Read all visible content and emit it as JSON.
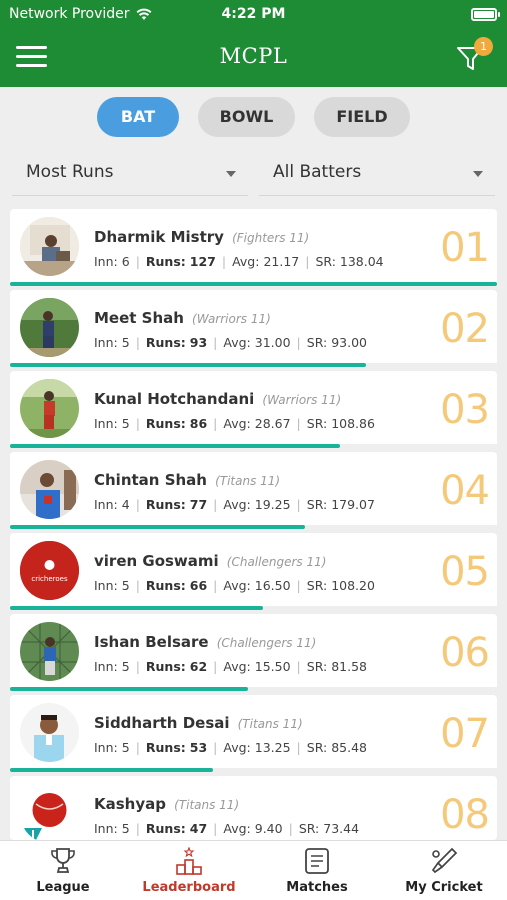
{
  "status_bar": {
    "carrier": "Network Provider",
    "time": "4:22 PM"
  },
  "header": {
    "title": "MCPL",
    "filter_badge": "1"
  },
  "tabs": [
    {
      "label": "BAT",
      "active": true
    },
    {
      "label": "BOWL",
      "active": false
    },
    {
      "label": "FIELD",
      "active": false
    }
  ],
  "filters": {
    "stat": "Most Runs",
    "players": "All Batters"
  },
  "labels": {
    "inn": "Inn:",
    "runs": "Runs:",
    "avg": "Avg:",
    "sr": "SR:"
  },
  "players": [
    {
      "rank": "01",
      "name": "Dharmik Mistry",
      "team": "(Fighters 11)",
      "inn": "6",
      "runs": "127",
      "avg": "21.17",
      "sr": "138.04",
      "progress": 1.0
    },
    {
      "rank": "02",
      "name": "Meet Shah",
      "team": "(Warriors 11)",
      "inn": "5",
      "runs": "93",
      "avg": "31.00",
      "sr": "93.00",
      "progress": 0.732
    },
    {
      "rank": "03",
      "name": "Kunal Hotchandani",
      "team": "(Warriors 11)",
      "inn": "5",
      "runs": "86",
      "avg": "28.67",
      "sr": "108.86",
      "progress": 0.677
    },
    {
      "rank": "04",
      "name": "Chintan Shah",
      "team": "(Titans 11)",
      "inn": "4",
      "runs": "77",
      "avg": "19.25",
      "sr": "179.07",
      "progress": 0.606
    },
    {
      "rank": "05",
      "name": "viren Goswami",
      "team": "(Challengers 11)",
      "inn": "5",
      "runs": "66",
      "avg": "16.50",
      "sr": "108.20",
      "progress": 0.52,
      "avatar_text": "cricheroes"
    },
    {
      "rank": "06",
      "name": "Ishan Belsare",
      "team": "(Challengers 11)",
      "inn": "5",
      "runs": "62",
      "avg": "15.50",
      "sr": "81.58",
      "progress": 0.488
    },
    {
      "rank": "07",
      "name": "Siddharth Desai",
      "team": "(Titans 11)",
      "inn": "5",
      "runs": "53",
      "avg": "13.25",
      "sr": "85.48",
      "progress": 0.417
    },
    {
      "rank": "08",
      "name": "Kashyap",
      "team": "(Titans 11)",
      "inn": "5",
      "runs": "47",
      "avg": "9.40",
      "sr": "73.44",
      "progress": 0.37
    }
  ],
  "bottom_nav": [
    {
      "label": "League",
      "icon": "trophy-icon",
      "active": false
    },
    {
      "label": "Leaderboard",
      "icon": "podium-icon",
      "active": true
    },
    {
      "label": "Matches",
      "icon": "document-icon",
      "active": false
    },
    {
      "label": "My Cricket",
      "icon": "cricket-bat-icon",
      "active": false
    }
  ],
  "colors": {
    "primary_green": "#1e8c34",
    "active_tab": "#4a9ee0",
    "progress": "#19b39a",
    "rank": "#f5c97a",
    "badge": "#f2a93b",
    "active_nav": "#c0392b"
  }
}
